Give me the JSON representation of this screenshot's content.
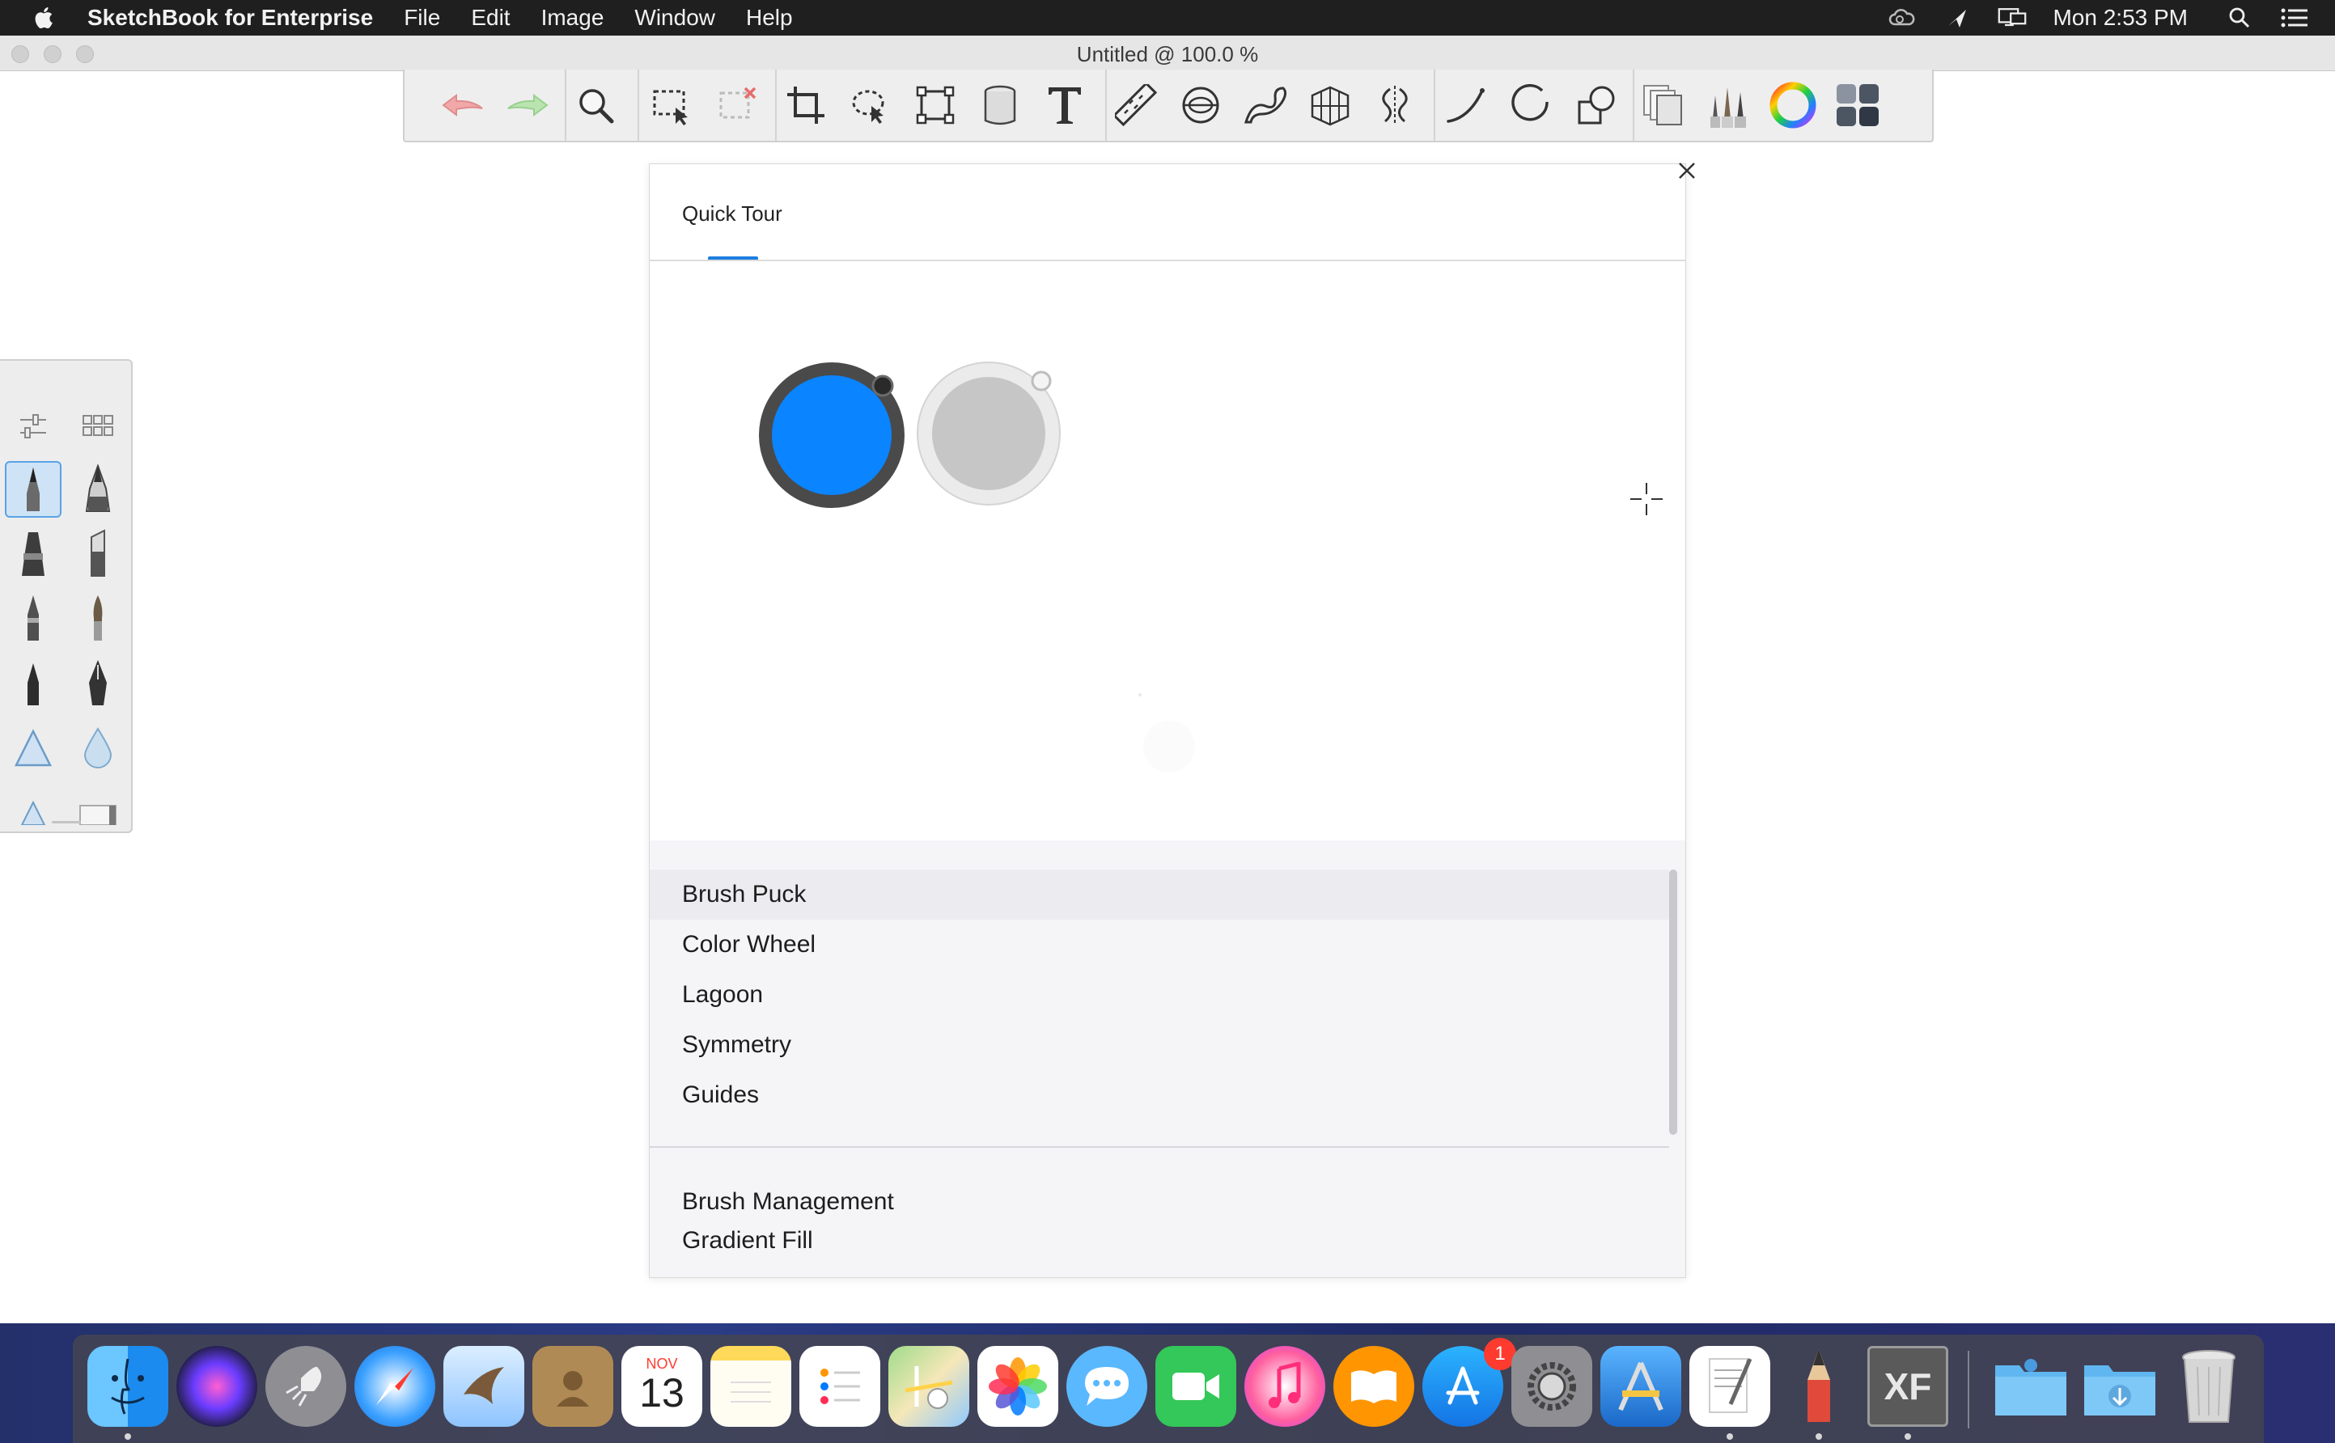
{
  "menubar": {
    "app_name": "SketchBook for Enterprise",
    "menus": [
      "File",
      "Edit",
      "Image",
      "Window",
      "Help"
    ],
    "clock": "Mon 2:53 PM",
    "status_icons": [
      "creative-cloud-icon",
      "airplay-icon",
      "display-icon",
      "spotlight-search-icon",
      "notification-center-icon"
    ]
  },
  "window": {
    "title": "Untitled @ 100.0 %"
  },
  "toolbar": {
    "tools": [
      "undo",
      "redo",
      "zoom",
      "select",
      "select-deselect",
      "crop",
      "lasso",
      "transform",
      "fill",
      "text",
      "ruler",
      "ellipse-guide",
      "french-curve",
      "perspective",
      "symmetry",
      "stroke",
      "circle",
      "shapes",
      "layers",
      "brush-library",
      "color-wheel",
      "brush-palette"
    ]
  },
  "dialog": {
    "tab_label": "Quick Tour",
    "list_items": [
      "Brush Puck",
      "Color Wheel",
      "Lagoon",
      "Symmetry",
      "Guides"
    ],
    "list_items_2": [
      "Brush Management",
      "Gradient Fill"
    ],
    "accent_color": "#1e7ee0",
    "puck_primary_color": "#0a84ff",
    "puck_secondary_color": "#c6c6c6"
  },
  "dock": {
    "apps": [
      "Finder",
      "Siri",
      "Launchpad",
      "Safari",
      "Mail",
      "Contacts",
      "Calendar",
      "Notes",
      "Reminders",
      "Maps",
      "Photos",
      "Messages",
      "FaceTime",
      "iTunes",
      "iBooks",
      "App Store",
      "System Preferences",
      "Instruments",
      "TextEdit",
      "SketchBook",
      "Xcode Fonts"
    ],
    "calendar_month": "NOV",
    "calendar_day": "13",
    "appstore_badge": "1",
    "xf_label": "XF",
    "folders": [
      "Applications",
      "Downloads",
      "Trash"
    ]
  }
}
